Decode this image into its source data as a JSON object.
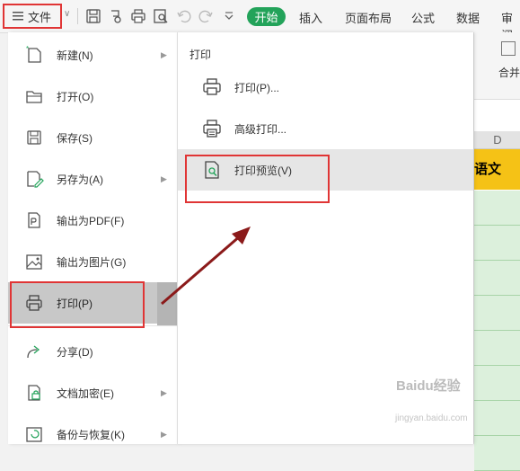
{
  "toolbar": {
    "file_label": "文件",
    "file_caret": "∨",
    "start_tab": "开始",
    "tabs": [
      "插入",
      "页面布局",
      "公式",
      "数据",
      "审阅"
    ]
  },
  "sheet": {
    "merge_label": "合并",
    "col_header": "D",
    "cell_text": "语文"
  },
  "menu": {
    "items": [
      {
        "label": "新建(N)",
        "icon": "new-file-icon",
        "arrow": "▶"
      },
      {
        "label": "打开(O)",
        "icon": "folder-icon",
        "arrow": ""
      },
      {
        "label": "保存(S)",
        "icon": "save-icon",
        "arrow": ""
      },
      {
        "label": "另存为(A)",
        "icon": "save-as-icon",
        "arrow": "▶"
      },
      {
        "label": "输出为PDF(F)",
        "icon": "pdf-icon",
        "arrow": ""
      },
      {
        "label": "输出为图片(G)",
        "icon": "image-icon",
        "arrow": ""
      },
      {
        "label": "打印(P)",
        "icon": "printer-icon",
        "arrow": ""
      },
      {
        "label": "分享(D)",
        "icon": "share-icon",
        "arrow": ""
      },
      {
        "label": "文档加密(E)",
        "icon": "encrypt-icon",
        "arrow": "▶"
      },
      {
        "label": "备份与恢复(K)",
        "icon": "backup-icon",
        "arrow": "▶"
      }
    ]
  },
  "submenu": {
    "title": "打印",
    "items": [
      {
        "label": "打印(P)...",
        "icon": "printer-icon"
      },
      {
        "label": "高级打印...",
        "icon": "advanced-print-icon"
      },
      {
        "label": "打印预览(V)",
        "icon": "print-preview-icon"
      }
    ]
  },
  "colors": {
    "accent_green": "#23a35a",
    "highlight_red": "#e03535",
    "arrow_red": "#8b1a1a",
    "cell_yellow": "#f5c216",
    "cell_green": "#dcf0dc"
  },
  "watermark": {
    "main": "Baidu经验",
    "sub": "jingyan.baidu.com"
  }
}
